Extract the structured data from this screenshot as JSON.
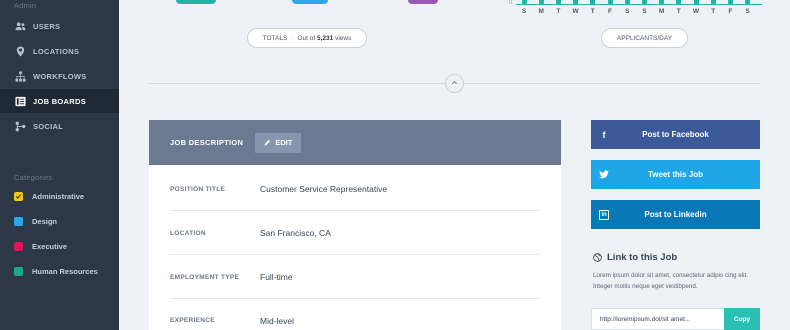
{
  "sidebar": {
    "admin_heading": "Admin",
    "items": [
      {
        "label": "USERS",
        "icon": "users-icon"
      },
      {
        "label": "LOCATIONS",
        "icon": "location-pin-icon"
      },
      {
        "label": "WORKFLOWS",
        "icon": "workflow-icon"
      },
      {
        "label": "JOB BOARDS",
        "icon": "job-boards-icon",
        "active": true
      },
      {
        "label": "SOCIAL",
        "icon": "social-icon"
      }
    ],
    "categories_heading": "Categories",
    "categories": [
      {
        "label": "Administrative",
        "color": "#f2c811",
        "checked": true
      },
      {
        "label": "Design",
        "color": "#2ea6e8"
      },
      {
        "label": "Executive",
        "color": "#e8125c"
      },
      {
        "label": "Human Resources",
        "color": "#1ea88a"
      }
    ]
  },
  "stats": {
    "totals_label": "TOTALS",
    "totals_separator": "·",
    "totals_prefix": "Out of",
    "totals_count": "5,231",
    "totals_suffix": "views",
    "applicants_label": "APPLICANTS/DAY",
    "axis_zero": "0",
    "days": [
      "S",
      "M",
      "T",
      "W",
      "T",
      "F",
      "S",
      "S",
      "M",
      "T",
      "W",
      "T",
      "F",
      "S"
    ],
    "arc_colors": [
      "#20b3a6",
      "#2ea6e8",
      "#9b59b6"
    ]
  },
  "job": {
    "header_title": "JOB DESCRIPTION",
    "edit_label": "EDIT",
    "rows": [
      {
        "label": "POSITION TITLE",
        "value": "Customer Service Representative"
      },
      {
        "label": "LOCATION",
        "value": "San Francisco, CA"
      },
      {
        "label": "EMPLOYMENT TYPE",
        "value": "Full-time"
      },
      {
        "label": "EXPERIENCE",
        "value": "Mid-level"
      }
    ]
  },
  "share": {
    "facebook_label": "Post to Facebook",
    "facebook_icon_text": "f",
    "facebook_color": "#3c5a9a",
    "twitter_label": "Tweet this Job",
    "twitter_color": "#1fa6e8",
    "linkedin_label": "Post to Linkedin",
    "linkedin_icon_text": "in",
    "linkedin_color": "#0a78b6",
    "link_title": "Link to this Job",
    "link_desc": "Lorem ipsum dolor sit amet, consectetur adipis cing elit. Integer mollis neque eget vestibpend.",
    "url_value": "http://loremipsum.dol/sit amet...",
    "copy_label": "Copy"
  }
}
